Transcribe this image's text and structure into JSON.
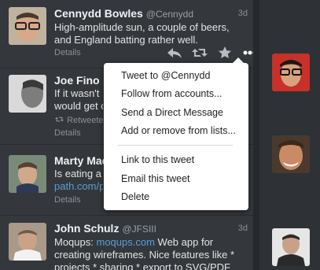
{
  "tweets": [
    {
      "name": "Cennydd Bowles",
      "handle": "@Cennydd",
      "time": "3d",
      "lines": [
        "High-amplitude sun, a couple of beers,",
        "and England batting rather well."
      ],
      "details": "Details"
    },
    {
      "name": "Joe Fino",
      "lines": [
        "If it wasn't",
        "would get c"
      ],
      "retweeted": "Retweete",
      "details": "Details"
    },
    {
      "name": "Marty Mac",
      "lines": [
        "Is eating a",
        "path.com/p"
      ],
      "details": "Details"
    },
    {
      "name": "John Schulz",
      "handle": "@JFSIII",
      "time": "3d",
      "line1_prefix": "Moqups:",
      "line1_link": "moqups.com",
      "line1_suffix": "Web app for",
      "line2": "creating wireframes. Nice features like *",
      "line3": "projects * sharing * export to SVG/PDF"
    }
  ],
  "menu": {
    "items": [
      "Tweet to @Cennydd",
      "Follow from accounts...",
      "Send a Direct Message",
      "Add or remove from lists...",
      "Link to this tweet",
      "Email this tweet",
      "Delete"
    ]
  },
  "icons": [
    "reply-icon",
    "retweet-icon",
    "favorite-icon",
    "more-icon"
  ],
  "colors": {
    "link": "#5a9fd6",
    "background": "#34373c",
    "menu_bg": "#ffffff"
  }
}
